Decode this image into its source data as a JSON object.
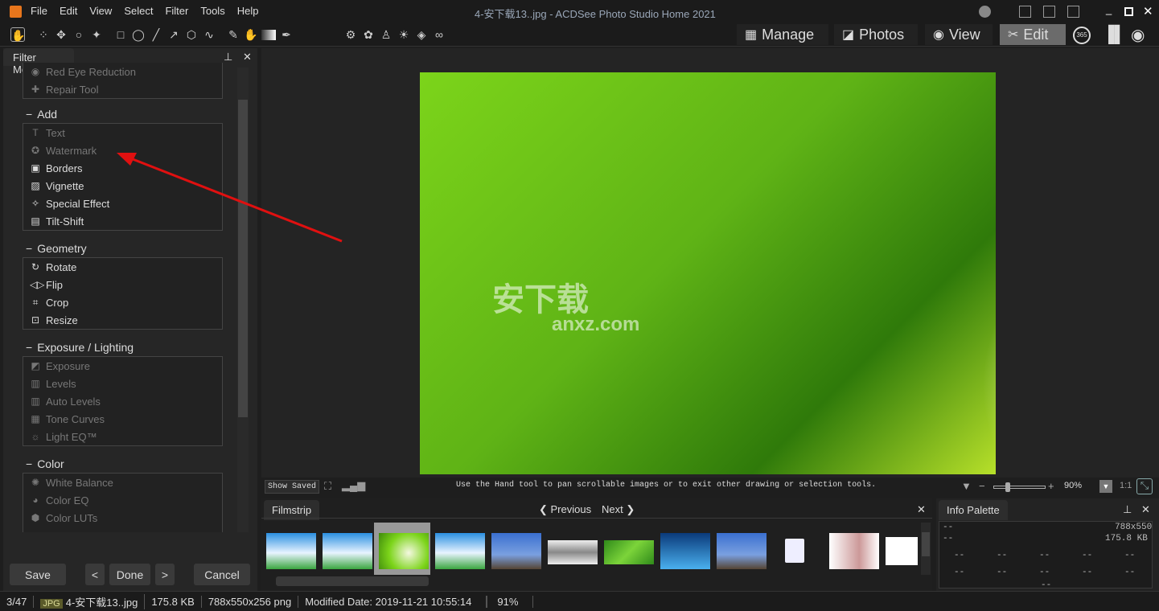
{
  "app": {
    "title": "4-安下载13..jpg - ACDSee Photo Studio Home 2021"
  },
  "menu": [
    "File",
    "Edit",
    "View",
    "Select",
    "Filter",
    "Tools",
    "Help"
  ],
  "modes": [
    {
      "label": "Manage",
      "icon": "grid-icon"
    },
    {
      "label": "Photos",
      "icon": "photos-icon"
    },
    {
      "label": "View",
      "icon": "eye-icon"
    },
    {
      "label": "Edit",
      "icon": "edit-icon",
      "active": true
    }
  ],
  "panel": {
    "title": "Filter Menu",
    "top_items": [
      {
        "label": "Red Eye Reduction",
        "icon": "eye-icon",
        "disabled": true
      },
      {
        "label": "Repair Tool",
        "icon": "bandage-icon",
        "disabled": true
      }
    ],
    "sections": [
      {
        "title": "Add",
        "items": [
          {
            "label": "Text",
            "icon": "T",
            "disabled": true
          },
          {
            "label": "Watermark",
            "icon": "✪",
            "disabled": true
          },
          {
            "label": "Borders",
            "icon": "▣"
          },
          {
            "label": "Vignette",
            "icon": "▨"
          },
          {
            "label": "Special Effect",
            "icon": "✧"
          },
          {
            "label": "Tilt-Shift",
            "icon": "▤"
          }
        ]
      },
      {
        "title": "Geometry",
        "items": [
          {
            "label": "Rotate",
            "icon": "↻"
          },
          {
            "label": "Flip",
            "icon": "◁▷"
          },
          {
            "label": "Crop",
            "icon": "⌗"
          },
          {
            "label": "Resize",
            "icon": "⊡"
          }
        ]
      },
      {
        "title": "Exposure / Lighting",
        "items": [
          {
            "label": "Exposure",
            "icon": "◩",
            "disabled": true
          },
          {
            "label": "Levels",
            "icon": "▥",
            "disabled": true
          },
          {
            "label": "Auto Levels",
            "icon": "▥",
            "disabled": true
          },
          {
            "label": "Tone Curves",
            "icon": "▦",
            "disabled": true
          },
          {
            "label": "Light EQ™",
            "icon": "☼",
            "disabled": true
          }
        ]
      },
      {
        "title": "Color",
        "items": [
          {
            "label": "White Balance",
            "icon": "✺",
            "disabled": true
          },
          {
            "label": "Color EQ",
            "icon": "◕",
            "disabled": true
          },
          {
            "label": "Color LUTs",
            "icon": "⬢",
            "disabled": true
          }
        ]
      }
    ],
    "buttons": {
      "save": "Save",
      "done": "Done",
      "cancel": "Cancel",
      "prev": "<",
      "next": ">"
    }
  },
  "viewer": {
    "watermark": "安下载",
    "watermark_sub": "anxz.com",
    "show_saved": "Show Saved",
    "hint": "Use the Hand tool to pan scrollable images or to exit other drawing or selection tools.",
    "zoom": "90%",
    "one_to_one": "1:1"
  },
  "filmstrip": {
    "title": "Filmstrip",
    "previous": "Previous",
    "next": "Next"
  },
  "info": {
    "title": "Info Palette",
    "left1": "--",
    "left2": "--",
    "dims": "788x550",
    "size": "175.8 KB",
    "blank": "--"
  },
  "status": {
    "index": "3/47",
    "type": "JPG",
    "filename": "4-安下载13..jpg",
    "size": "175.8 KB",
    "dims": "788x550x256 png",
    "modified": "Modified Date: 2019-11-21 10:55:14",
    "zoom": "91%"
  },
  "colors": {
    "accent": "#6b6b6b",
    "arrow": "#e01010"
  }
}
